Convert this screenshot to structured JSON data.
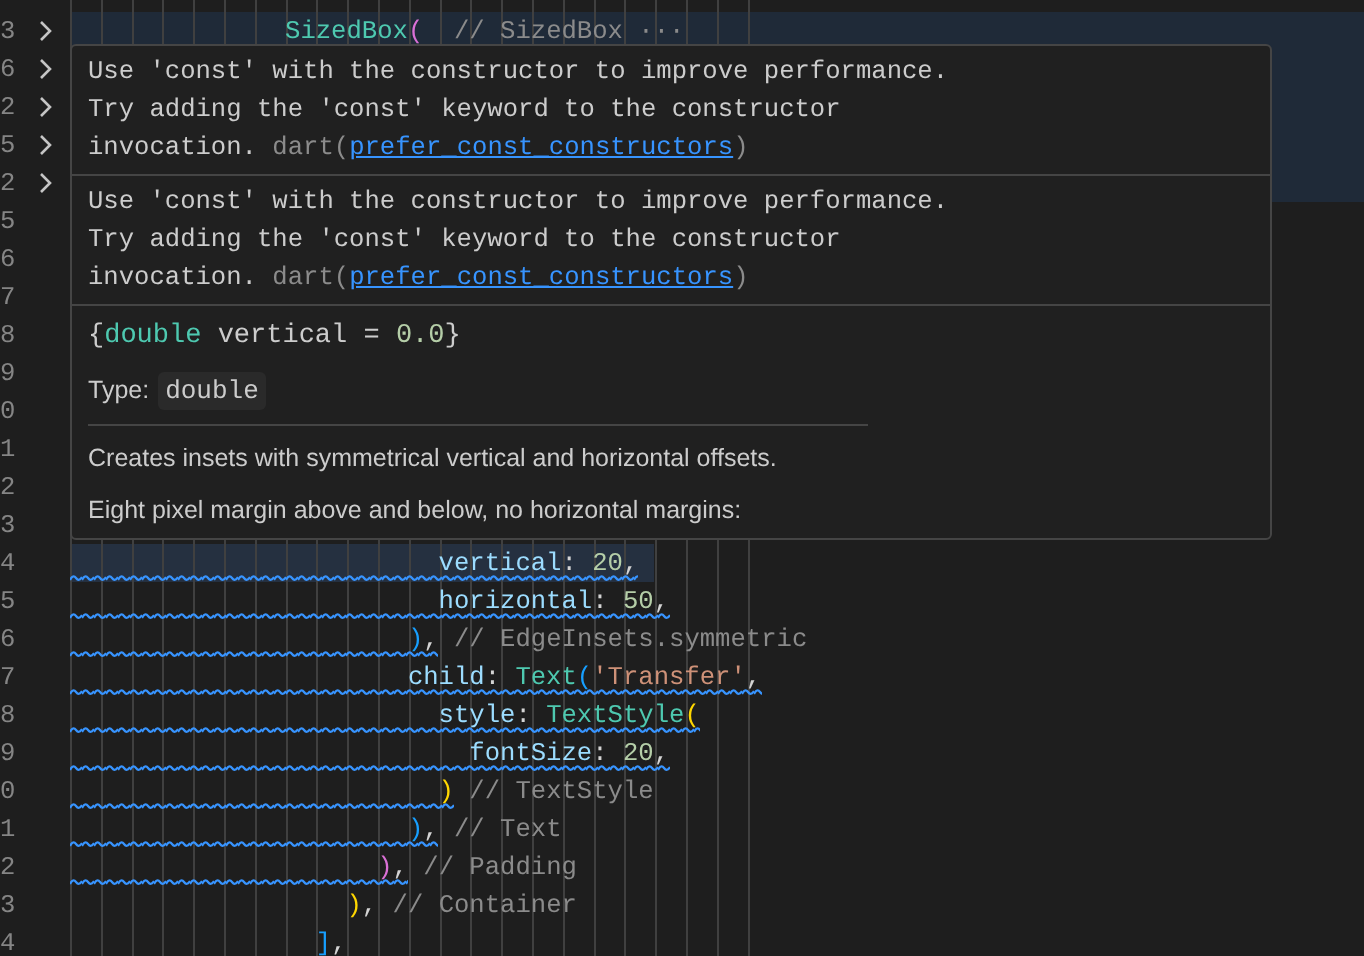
{
  "editor": {
    "lines": [
      {
        "number": "3",
        "folded": true,
        "line_highlight": true,
        "tokens": [
          {
            "text": "              SizedBox",
            "kind": "class"
          },
          {
            "text": "(",
            "kind": "bracket2"
          },
          {
            "text": "  // SizedBox",
            "kind": "comment"
          },
          {
            "text": " ···",
            "kind": "fold"
          }
        ]
      },
      {
        "number": "6",
        "folded": true,
        "line_highlight": true
      },
      {
        "number": "2",
        "folded": true,
        "line_highlight": true
      },
      {
        "number": "5",
        "folded": true,
        "line_highlight": true
      },
      {
        "number": "2",
        "folded": true,
        "line_highlight": true
      },
      {
        "number": "5",
        "folded": false
      },
      {
        "number": "6",
        "folded": false
      },
      {
        "number": "7",
        "folded": false
      },
      {
        "number": "8",
        "folded": false
      },
      {
        "number": "9",
        "folded": false
      },
      {
        "number": "0",
        "folded": false
      },
      {
        "number": "1",
        "folded": false
      },
      {
        "number": "2",
        "folded": false
      },
      {
        "number": "3",
        "folded": false
      },
      {
        "number": "4",
        "folded": false,
        "range_highlight": true,
        "squiggle": true,
        "tokens": [
          {
            "text": "                        vertical",
            "kind": "property"
          },
          {
            "text": ": ",
            "kind": "plain"
          },
          {
            "text": "20",
            "kind": "number"
          },
          {
            "text": ",",
            "kind": "plain"
          }
        ]
      },
      {
        "number": "5",
        "folded": false,
        "squiggle": true,
        "tokens": [
          {
            "text": "                        horizontal",
            "kind": "property"
          },
          {
            "text": ": ",
            "kind": "plain"
          },
          {
            "text": "50",
            "kind": "number"
          },
          {
            "text": ",",
            "kind": "plain"
          }
        ]
      },
      {
        "number": "6",
        "folded": false,
        "squiggle": true,
        "tokens": [
          {
            "text": "                      )",
            "kind": "bracket3"
          },
          {
            "text": ",",
            "kind": "plain"
          },
          {
            "text": " // EdgeInsets.symmetric",
            "kind": "comment"
          }
        ]
      },
      {
        "number": "7",
        "folded": false,
        "squiggle": true,
        "tokens": [
          {
            "text": "                      child",
            "kind": "property"
          },
          {
            "text": ": ",
            "kind": "plain"
          },
          {
            "text": "Text",
            "kind": "class"
          },
          {
            "text": "(",
            "kind": "bracket3"
          },
          {
            "text": "'Transfer'",
            "kind": "string"
          },
          {
            "text": ",",
            "kind": "plain"
          }
        ]
      },
      {
        "number": "8",
        "folded": false,
        "squiggle": true,
        "tokens": [
          {
            "text": "                        style",
            "kind": "property"
          },
          {
            "text": ": ",
            "kind": "plain"
          },
          {
            "text": "TextStyle",
            "kind": "class"
          },
          {
            "text": "(",
            "kind": "bracket1"
          }
        ]
      },
      {
        "number": "9",
        "folded": false,
        "squiggle": true,
        "tokens": [
          {
            "text": "                          fontSize",
            "kind": "property"
          },
          {
            "text": ": ",
            "kind": "plain"
          },
          {
            "text": "20",
            "kind": "number"
          },
          {
            "text": ",",
            "kind": "plain"
          }
        ]
      },
      {
        "number": "0",
        "folded": false,
        "squiggle": true,
        "tokens": [
          {
            "text": "                        )",
            "kind": "bracket1"
          },
          {
            "text": " // TextStyle",
            "kind": "comment"
          }
        ]
      },
      {
        "number": "1",
        "folded": false,
        "squiggle": true,
        "tokens": [
          {
            "text": "                      )",
            "kind": "bracket3"
          },
          {
            "text": ",",
            "kind": "plain"
          },
          {
            "text": " // Text",
            "kind": "comment"
          }
        ]
      },
      {
        "number": "2",
        "folded": false,
        "squiggle": true,
        "tokens": [
          {
            "text": "                    )",
            "kind": "bracket2"
          },
          {
            "text": ",",
            "kind": "plain"
          },
          {
            "text": " // Padding",
            "kind": "comment"
          }
        ]
      },
      {
        "number": "3",
        "folded": false,
        "tokens": [
          {
            "text": "                  )",
            "kind": "bracket1"
          },
          {
            "text": ",",
            "kind": "plain"
          },
          {
            "text": " // Container",
            "kind": "comment"
          }
        ]
      },
      {
        "number": "4",
        "folded": false,
        "tokens": [
          {
            "text": "                ]",
            "kind": "bracket3"
          },
          {
            "text": ",",
            "kind": "plain"
          }
        ]
      }
    ]
  },
  "hover": {
    "diagnostics": [
      {
        "lines": [
          "Use 'const' with the constructor to improve performance.",
          "Try adding the 'const' keyword to the constructor",
          "invocation."
        ],
        "source": "dart(",
        "rule": "prefer_const_constructors",
        "close": ")"
      },
      {
        "lines": [
          "Use 'const' with the constructor to improve performance.",
          "Try adding the 'const' keyword to the constructor",
          "invocation."
        ],
        "source": "dart(",
        "rule": "prefer_const_constructors",
        "close": ")"
      }
    ],
    "signature": [
      {
        "text": "{",
        "kind": "plain"
      },
      {
        "text": "double",
        "kind": "type"
      },
      {
        "text": " vertical = ",
        "kind": "plain"
      },
      {
        "text": "0.0",
        "kind": "number"
      },
      {
        "text": "}",
        "kind": "plain"
      }
    ],
    "type_label": "Type:",
    "type_value": "double",
    "docs": [
      "Creates insets with symmetrical vertical and horizontal offsets.",
      "Eight pixel margin above and below, no horizontal margins:"
    ]
  }
}
